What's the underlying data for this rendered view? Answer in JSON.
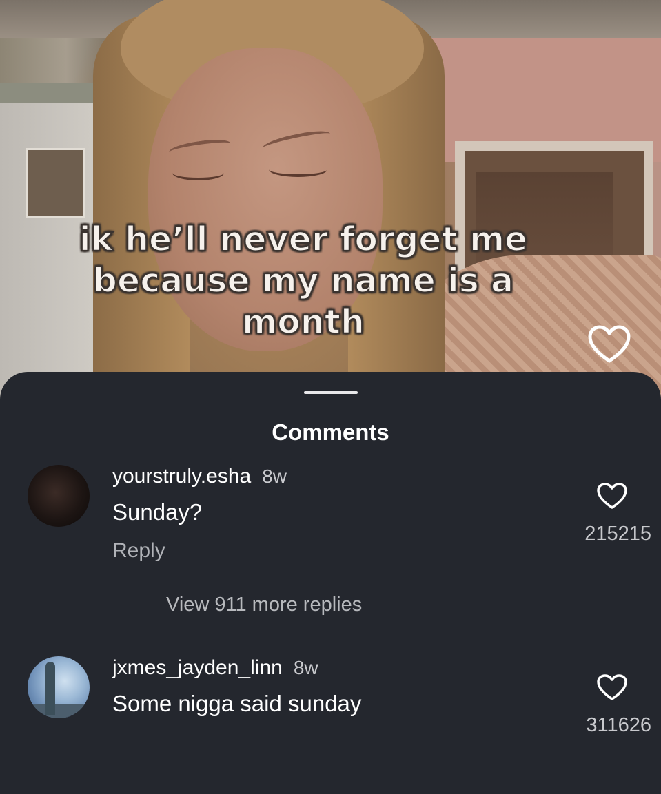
{
  "video": {
    "overlay_lines": [
      "ik he’ll never forget me",
      "because my name is a",
      "month"
    ],
    "like_icon": "heart-icon"
  },
  "comments_sheet": {
    "title": "Comments",
    "comments": [
      {
        "username": "yourstruly.esha",
        "time": "8w",
        "text": "Sunday?",
        "reply_label": "Reply",
        "like_count": "215215",
        "view_replies": "View 911 more replies"
      },
      {
        "username": "jxmes_jayden_linn",
        "time": "8w",
        "text": "Some nigga said sunday",
        "like_count": "311626"
      }
    ]
  },
  "colors": {
    "sheet_background": "#24272e",
    "primary_text": "#ffffff",
    "secondary_text": "#b1b3b8"
  }
}
